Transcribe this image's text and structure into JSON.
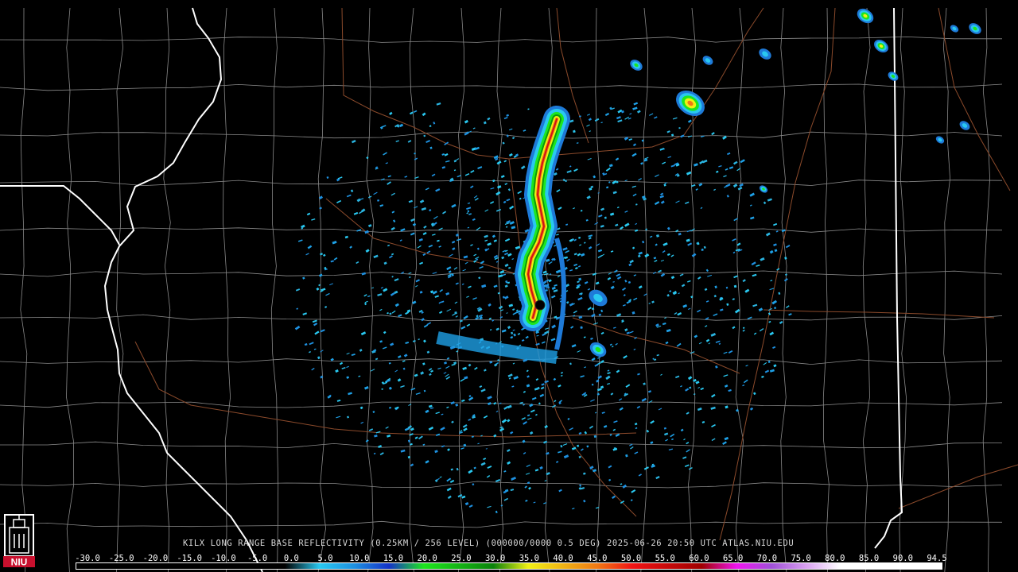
{
  "product": {
    "caption": "KILX LONG RANGE BASE REFLECTIVITY (0.25KM / 256 LEVEL) (000000/0000 0.5 DEG) 2025-06-26 20:50 UTC  ATLAS.NIU.EDU"
  },
  "logo": {
    "text": "NIU",
    "icon": "niu-tower-logo",
    "accent_color": "#c8102e"
  },
  "colorbar": {
    "tick_labels": [
      "-30.0",
      "-25.0",
      "-20.0",
      "-15.0",
      "-10.0",
      "-5.0",
      "0.0",
      "5.0",
      "10.0",
      "15.0",
      "20.0",
      "25.0",
      "30.0",
      "35.0",
      "40.0",
      "45.0",
      "50.0",
      "55.0",
      "60.0",
      "65.0",
      "70.0",
      "75.0",
      "80.0",
      "85.0",
      "90.0",
      "94.5"
    ],
    "min": -30.0,
    "max": 94.5,
    "stops": [
      {
        "value": -30,
        "color": "#000000"
      },
      {
        "value": 0,
        "color": "#000000"
      },
      {
        "value": 5,
        "color": "#29c8f0"
      },
      {
        "value": 10,
        "color": "#1e90e0"
      },
      {
        "value": 15,
        "color": "#1432c8"
      },
      {
        "value": 20,
        "color": "#1ee61e"
      },
      {
        "value": 25,
        "color": "#14b414"
      },
      {
        "value": 30,
        "color": "#0a820a"
      },
      {
        "value": 35,
        "color": "#f0f014"
      },
      {
        "value": 40,
        "color": "#f0b414"
      },
      {
        "value": 45,
        "color": "#f07814"
      },
      {
        "value": 50,
        "color": "#f01414"
      },
      {
        "value": 55,
        "color": "#c80a0a"
      },
      {
        "value": 60,
        "color": "#a00000"
      },
      {
        "value": 65,
        "color": "#f014f0"
      },
      {
        "value": 70,
        "color": "#a050d8"
      },
      {
        "value": 75,
        "color": "#d8a0f0"
      },
      {
        "value": 80,
        "color": "#ffffff"
      },
      {
        "value": 94.5,
        "color": "#ffffff"
      }
    ]
  },
  "map_colors": {
    "background": "#000000",
    "county_lines": "#8a8a8a",
    "state_lines": "#ffffff",
    "highways": "#8b4a2b",
    "radar_site": "#000000"
  }
}
